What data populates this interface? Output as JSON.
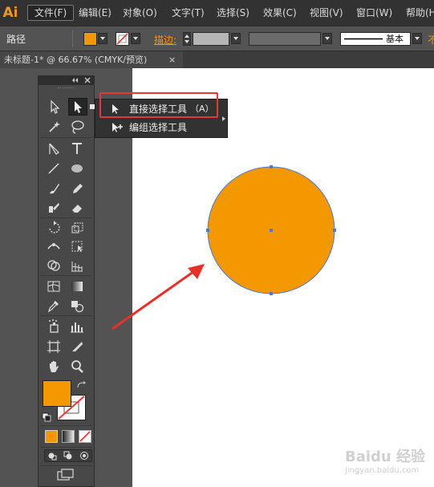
{
  "app": {
    "logo": "Ai"
  },
  "menu": {
    "items": [
      "文件(F)",
      "编辑(E)",
      "对象(O)",
      "文字(T)",
      "选择(S)",
      "效果(C)",
      "视图(V)",
      "窗口(W)",
      "帮助(H)"
    ]
  },
  "control_bar": {
    "selection_type": "路径",
    "stroke_label": "描边:",
    "brush_label": "基本",
    "fill_color": "#f39800",
    "trailing_char": "不"
  },
  "document_tab": {
    "title": "未标题-1* @ 66.67% (CMYK/预览)",
    "close": "×"
  },
  "flyout": {
    "items": [
      {
        "label": "直接选择工具",
        "shortcut": "（A）"
      },
      {
        "label": "编组选择工具",
        "shortcut": ""
      }
    ]
  },
  "colors": {
    "fill": "#f39800",
    "highlight": "#e53935",
    "arrow": "#e8302a",
    "selection": "#4a78d6"
  },
  "watermark": {
    "text": "Baidu 经验",
    "url": "jingyan.baidu.com"
  }
}
